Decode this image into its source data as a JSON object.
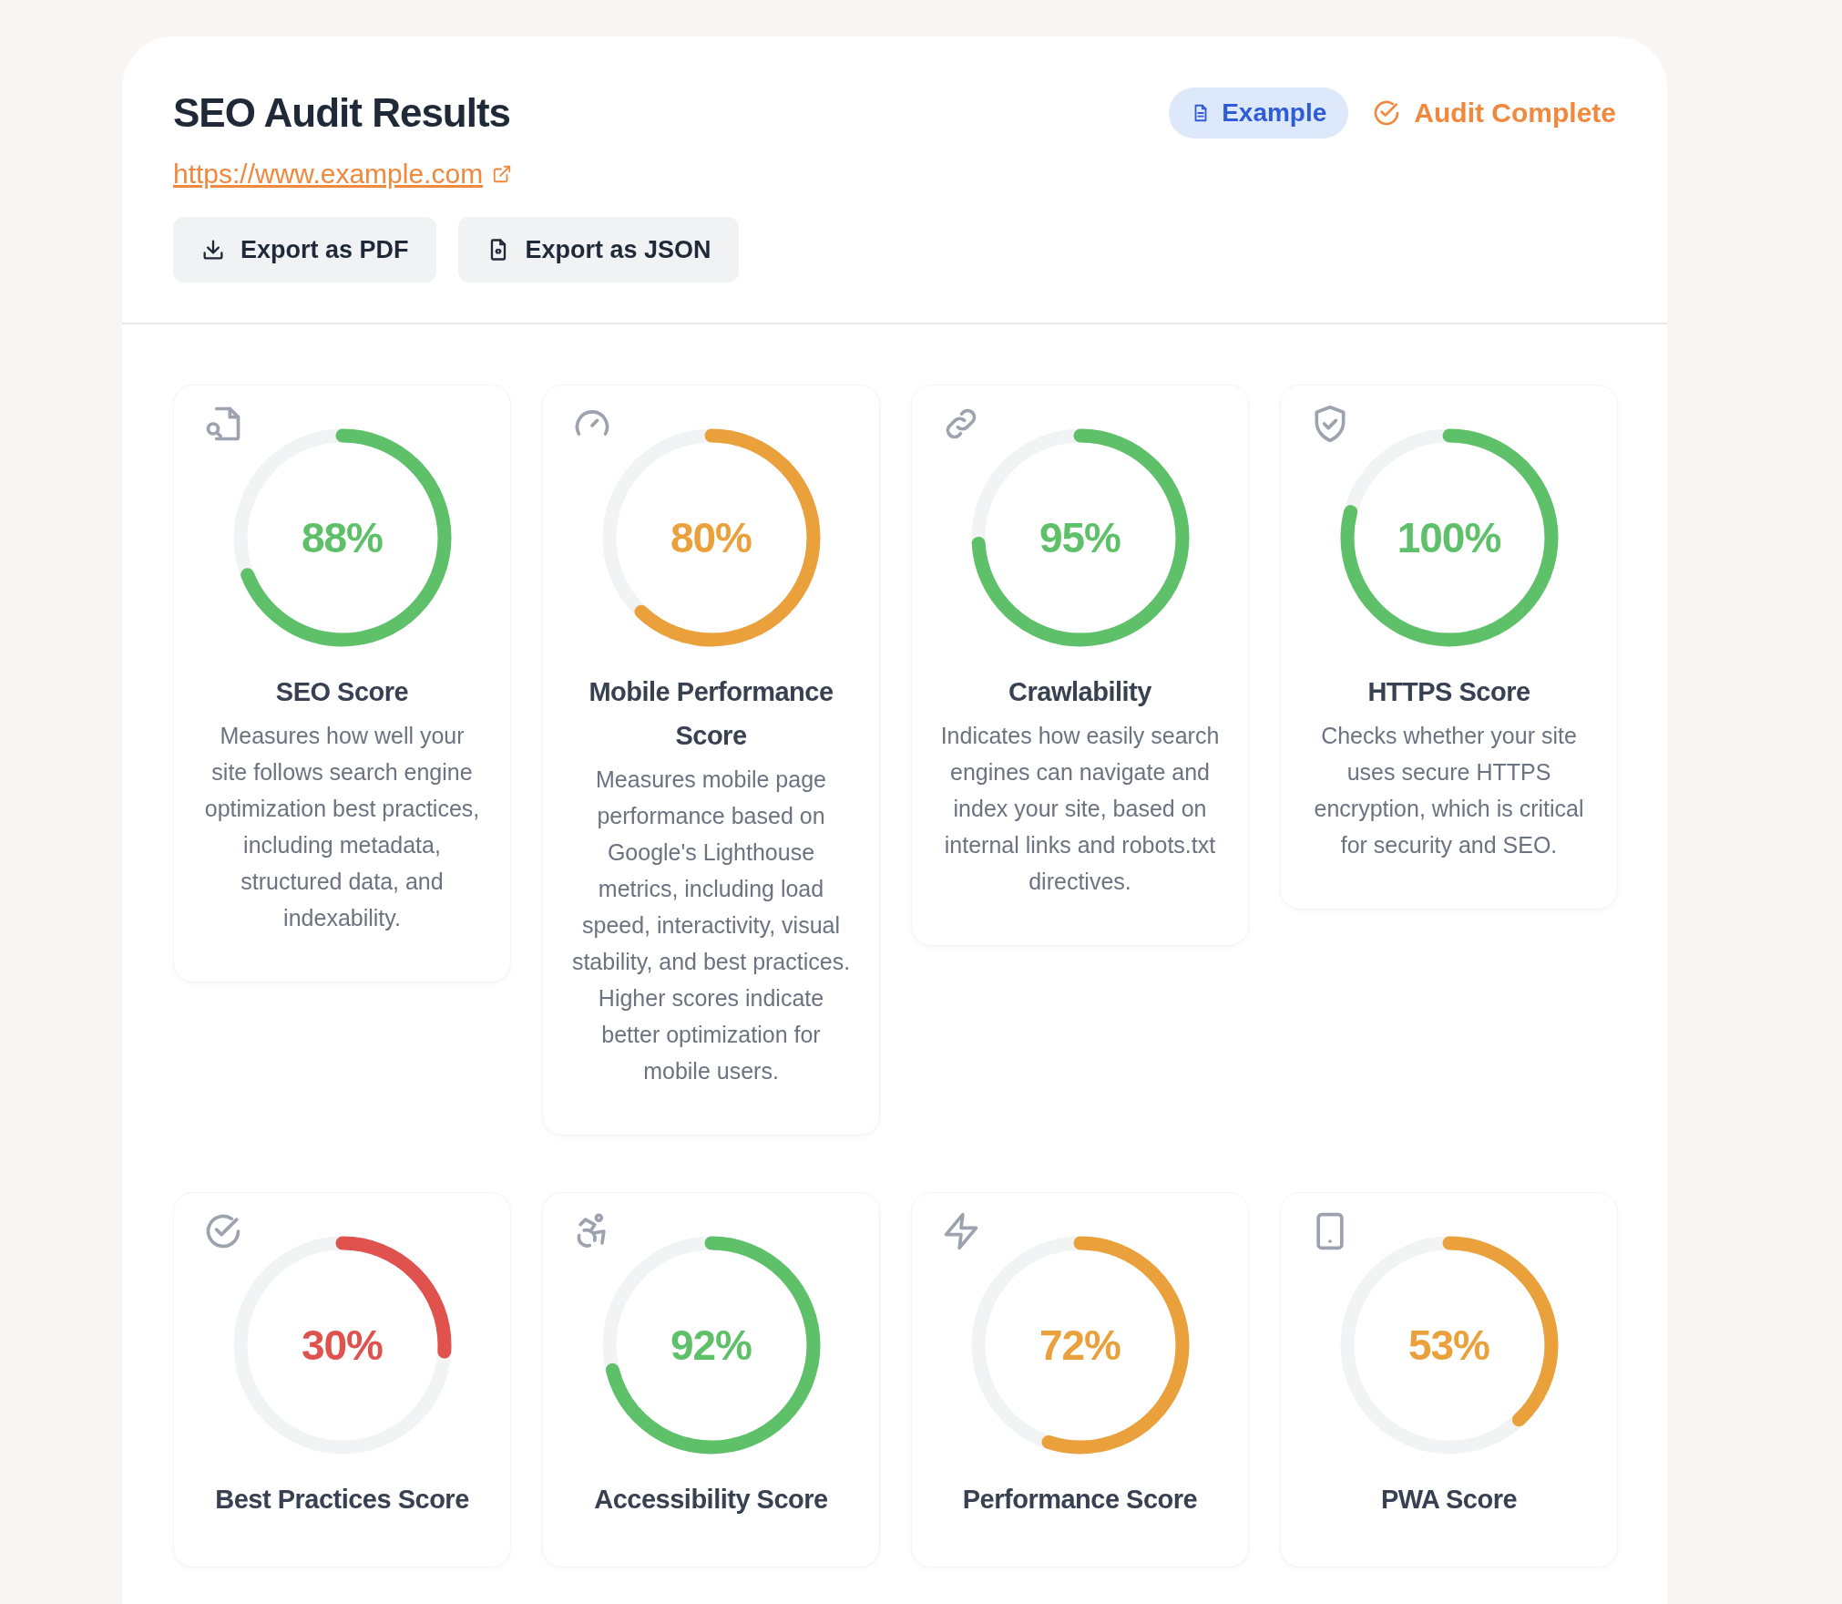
{
  "header": {
    "title": "SEO Audit Results",
    "url": "https://www.example.com",
    "badge": "Example",
    "status": "Audit Complete",
    "buttons": [
      {
        "label": "Export as PDF",
        "kind": "download"
      },
      {
        "label": "Export as JSON",
        "kind": "file"
      }
    ]
  },
  "cards": [
    {
      "score": "88%",
      "level": 0.69,
      "color": "#5fc06a",
      "title": "SEO Score",
      "description": "Measures how well your site follows search engine optimization best practices, including metadata, structured data, and indexability."
    },
    {
      "score": "80%",
      "level": 0.62,
      "color": "#eaa03b",
      "title": "Mobile Performance Score",
      "description": "Measures mobile page performance based on Google's Lighthouse metrics, including load speed, interactivity, visual stability, and best practices. Higher scores indicate better optimization for mobile users."
    },
    {
      "score": "95%",
      "level": 0.74,
      "color": "#5fc06a",
      "title": "Crawlability",
      "description": "Indicates how easily search engines can navigate and index your site, based on internal links and robots.txt directives."
    },
    {
      "score": "100%",
      "level": 0.79,
      "color": "#5fc06a",
      "title": "HTTPS Score",
      "description": "Checks whether your site uses secure HTTPS encryption, which is critical for security and SEO."
    },
    {
      "score": "30%",
      "level": 0.26,
      "color": "#e0524e",
      "title": "Best Practices Score"
    },
    {
      "score": "92%",
      "level": 0.71,
      "color": "#5fc06a",
      "title": "Accessibility Score"
    },
    {
      "score": "72%",
      "level": 0.55,
      "color": "#eaa03b",
      "title": "Performance Score"
    },
    {
      "score": "53%",
      "level": 0.38,
      "color": "#eaa03b",
      "title": "PWA Score"
    }
  ]
}
